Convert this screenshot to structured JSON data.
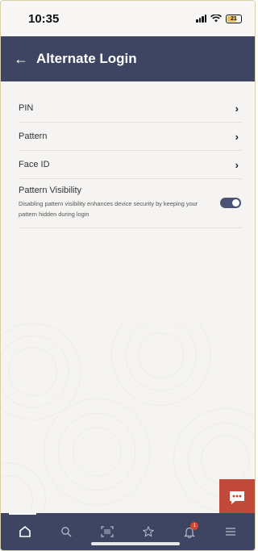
{
  "status_bar": {
    "time": "10:35",
    "battery_level": "21"
  },
  "header": {
    "back_icon": "arrow-left-icon",
    "title": "Alternate Login"
  },
  "menu": {
    "items": [
      {
        "label": "PIN",
        "icon": "chevron-right-icon"
      },
      {
        "label": "Pattern",
        "icon": "chevron-right-icon"
      },
      {
        "label": "Face ID",
        "icon": "chevron-right-icon"
      }
    ],
    "toggle": {
      "title": "Pattern Visibility",
      "description": "Disabling pattern visibility enhances device security by keeping your pattern hidden during login",
      "enabled": true
    }
  },
  "chat_fab": {
    "icon": "chat-bubble-icon"
  },
  "bottom_nav": {
    "items": [
      {
        "icon": "home-icon",
        "active": true
      },
      {
        "icon": "search-icon",
        "active": false
      },
      {
        "icon": "scan-icon",
        "active": false
      },
      {
        "icon": "star-icon",
        "active": false
      },
      {
        "icon": "bell-icon",
        "active": false,
        "badge": "1"
      },
      {
        "icon": "menu-icon",
        "active": false
      }
    ]
  },
  "colors": {
    "primary": "#3d4563",
    "accent": "#c24a3a",
    "background": "#f5f4f2"
  }
}
